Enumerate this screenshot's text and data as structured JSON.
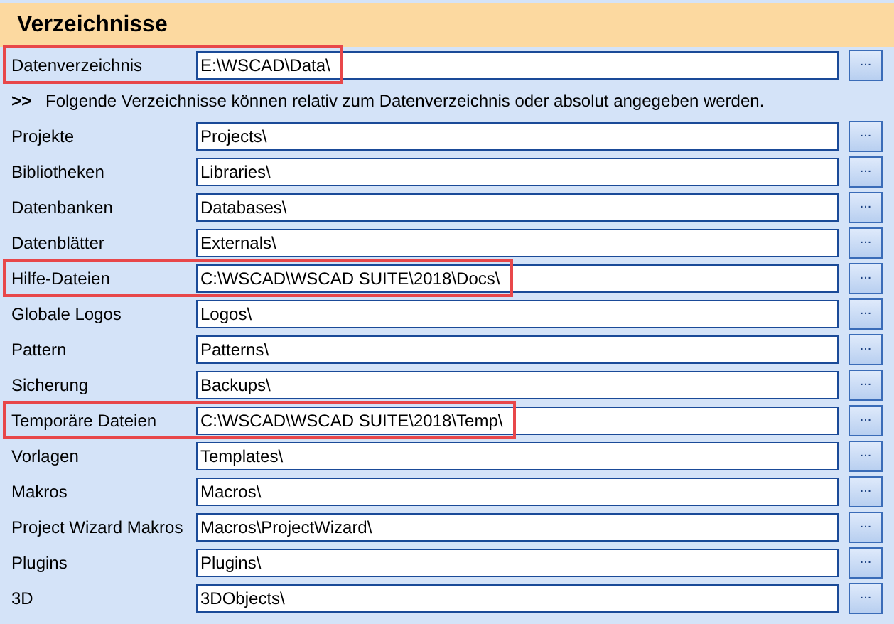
{
  "section": {
    "title": "Verzeichnisse"
  },
  "rows": [
    {
      "kind": "path",
      "label": "Datenverzeichnis",
      "value": "E:\\WSCAD\\Data\\",
      "button": "...",
      "highlighted": true
    },
    {
      "kind": "note",
      "marker": ">>",
      "text": "Folgende Verzeichnisse können relativ zum Datenverzeichnis oder absolut angegeben werden."
    },
    {
      "kind": "path",
      "label": "Projekte",
      "value": "Projects\\",
      "button": "...",
      "highlighted": false
    },
    {
      "kind": "path",
      "label": "Bibliotheken",
      "value": "Libraries\\",
      "button": "...",
      "highlighted": false
    },
    {
      "kind": "path",
      "label": "Datenbanken",
      "value": "Databases\\",
      "button": "...",
      "highlighted": false
    },
    {
      "kind": "path",
      "label": "Datenblätter",
      "value": "Externals\\",
      "button": "...",
      "highlighted": false
    },
    {
      "kind": "path",
      "label": "Hilfe-Dateien",
      "value": "C:\\WSCAD\\WSCAD SUITE\\2018\\Docs\\",
      "button": "...",
      "highlighted": true
    },
    {
      "kind": "path",
      "label": "Globale Logos",
      "value": "Logos\\",
      "button": "...",
      "highlighted": false
    },
    {
      "kind": "path",
      "label": "Pattern",
      "value": "Patterns\\",
      "button": "...",
      "highlighted": false
    },
    {
      "kind": "path",
      "label": "Sicherung",
      "value": "Backups\\",
      "button": "...",
      "highlighted": false
    },
    {
      "kind": "path",
      "label": "Temporäre Dateien",
      "value": "C:\\WSCAD\\WSCAD SUITE\\2018\\Temp\\",
      "button": "...",
      "highlighted": true
    },
    {
      "kind": "path",
      "label": "Vorlagen",
      "value": "Templates\\",
      "button": "...",
      "highlighted": false
    },
    {
      "kind": "path",
      "label": "Makros",
      "value": "Macros\\",
      "button": "...",
      "highlighted": false
    },
    {
      "kind": "path",
      "label": "Project Wizard Makros",
      "value": "Macros\\ProjectWizard\\",
      "button": "...",
      "highlighted": false
    },
    {
      "kind": "path",
      "label": "Plugins",
      "value": "Plugins\\",
      "button": "...",
      "highlighted": false
    },
    {
      "kind": "path",
      "label": "3D",
      "value": "3DObjects\\",
      "button": "...",
      "highlighted": false
    }
  ]
}
